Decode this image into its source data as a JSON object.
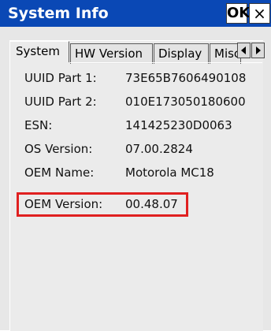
{
  "window": {
    "title": "System Info",
    "ok_label": "OK",
    "close_label": "×"
  },
  "tabs": [
    {
      "label": "System",
      "active": true
    },
    {
      "label": "HW Version",
      "active": false
    },
    {
      "label": "Display",
      "active": false
    },
    {
      "label": "Misc",
      "active": false
    }
  ],
  "tab_scroll": {
    "left_icon": "chevron-left-icon",
    "right_icon": "chevron-right-icon"
  },
  "info": [
    {
      "label": "UUID Part 1:",
      "value": "73E65B7606490108"
    },
    {
      "label": "UUID Part 2:",
      "value": "010E173050180600"
    },
    {
      "label": "ESN:",
      "value": "141425230D0063"
    },
    {
      "label": "OS Version:",
      "value": "07.00.2824"
    },
    {
      "label": "OEM Name:",
      "value": "Motorola MC18"
    },
    {
      "label": "OEM Version:",
      "value": "00.48.07"
    }
  ],
  "colors": {
    "titlebar": "#0a48b5",
    "highlight": "#e02020"
  }
}
